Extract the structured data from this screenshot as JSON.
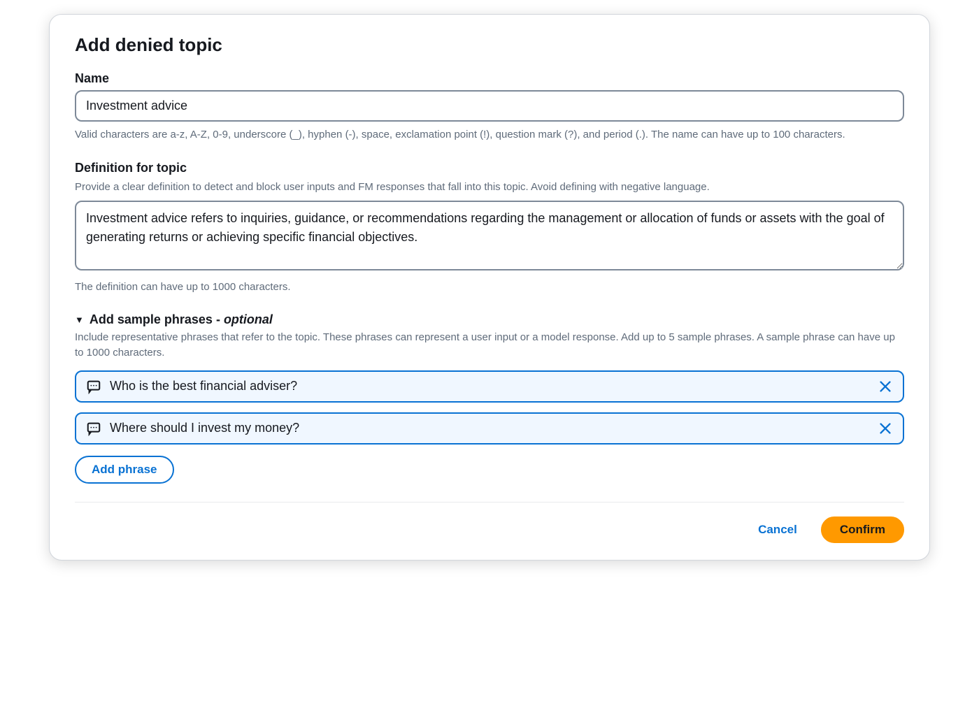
{
  "modal": {
    "title": "Add denied topic"
  },
  "name": {
    "label": "Name",
    "value": "Investment advice",
    "help": "Valid characters are a-z, A-Z, 0-9, underscore (_), hyphen (-), space, exclamation point (!), question mark (?), and period (.). The name can have up to 100 characters."
  },
  "definition": {
    "label": "Definition for topic",
    "sublabel": "Provide a clear definition to detect and block user inputs and FM responses that fall into this topic. Avoid defining with negative language.",
    "value": "Investment advice refers to inquiries, guidance, or recommendations regarding the management or allocation of funds or assets with the goal of generating returns or achieving specific financial objectives.",
    "help": "The definition can have up to 1000 characters."
  },
  "samplePhrases": {
    "title": "Add sample phrases - ",
    "optional": "optional",
    "sublabel": "Include representative phrases that refer to the topic. These phrases can represent a user input or a model response. Add up to 5 sample phrases. A sample phrase can have up to 1000 characters.",
    "items": [
      {
        "text": "Who is the best financial adviser?"
      },
      {
        "text": "Where should I invest my money?"
      }
    ],
    "addButton": "Add phrase"
  },
  "footer": {
    "cancel": "Cancel",
    "confirm": "Confirm"
  }
}
